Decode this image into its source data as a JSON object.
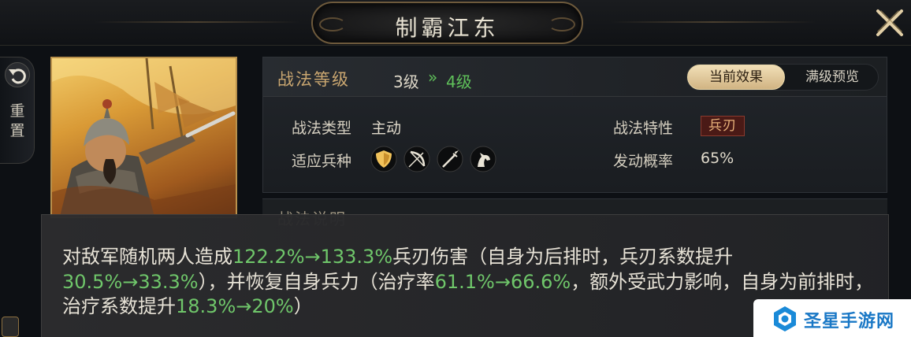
{
  "header": {
    "title": "制霸江东",
    "close_icon": "close-x-icon"
  },
  "sidebar": {
    "reset_icon": "undo-arrow-icon",
    "reset_label_1": "重",
    "reset_label_2": "置"
  },
  "skill": {
    "level_label": "战法等级",
    "level_from": "3级",
    "level_arrow": "»",
    "level_to": "4级",
    "tabs": [
      {
        "label": "当前效果",
        "active": true
      },
      {
        "label": "满级预览",
        "active": false
      }
    ],
    "type_label": "战法类型",
    "type_value": "主动",
    "trait_label": "战法特性",
    "trait_value": "兵刃",
    "troops_label": "适应兵种",
    "troop_icons": [
      "shield-icon",
      "bow-icon",
      "spear-icon",
      "horse-icon"
    ],
    "rate_label": "发动概率",
    "rate_value": "65%"
  },
  "description": {
    "section_title": "战法说明",
    "segments": [
      {
        "text": "对敌军随机两人造成",
        "highlight": false
      },
      {
        "text": "122.2%→133.3%",
        "highlight": true
      },
      {
        "text": "兵刃伤害（自身为后排时，兵刃系数提升",
        "highlight": false
      },
      {
        "text": "30.5%→33.3%",
        "highlight": true
      },
      {
        "text": "），并恢复自身兵力（治疗率",
        "highlight": false
      },
      {
        "text": "61.1%→66.6%",
        "highlight": true
      },
      {
        "text": "，额外受武力影响，自身为前排时，治疗系数提升",
        "highlight": false
      },
      {
        "text": "18.3%→20%",
        "highlight": true
      },
      {
        "text": "）",
        "highlight": false
      }
    ]
  },
  "colors": {
    "highlight_green": "#6fc66a",
    "gold_label": "#c9a670",
    "trait_red": "#4a1a16"
  },
  "watermark": {
    "text": "圣星手游网"
  }
}
